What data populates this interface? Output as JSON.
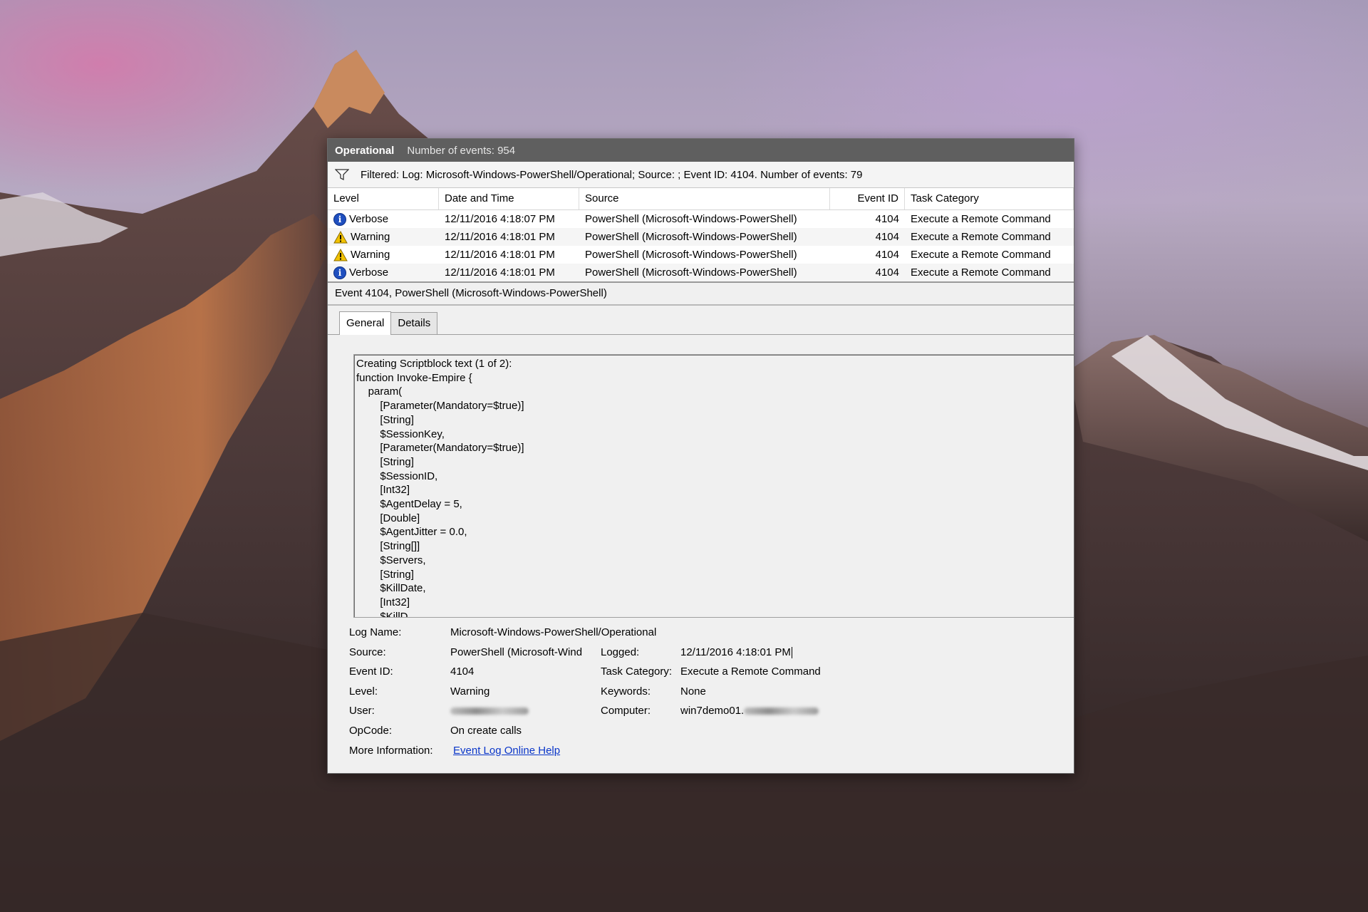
{
  "window": {
    "title": "Operational",
    "event_count": "Number of events: 954",
    "filter_text": "Filtered: Log: Microsoft-Windows-PowerShell/Operational; Source: ; Event ID: 4104. Number of events: 79"
  },
  "grid": {
    "headers": [
      "Level",
      "Date and Time",
      "Source",
      "Event ID",
      "Task Category"
    ],
    "rows": [
      {
        "level": "Verbose",
        "icon": "info-icon",
        "date": "12/11/2016 4:18:07 PM",
        "source": "PowerShell (Microsoft-Windows-PowerShell)",
        "event_id": "4104",
        "category": "Execute a Remote Command"
      },
      {
        "level": "Warning",
        "icon": "warning-icon",
        "date": "12/11/2016 4:18:01 PM",
        "source": "PowerShell (Microsoft-Windows-PowerShell)",
        "event_id": "4104",
        "category": "Execute a Remote Command"
      },
      {
        "level": "Warning",
        "icon": "warning-icon",
        "date": "12/11/2016 4:18:01 PM",
        "source": "PowerShell (Microsoft-Windows-PowerShell)",
        "event_id": "4104",
        "category": "Execute a Remote Command"
      },
      {
        "level": "Verbose",
        "icon": "info-icon",
        "date": "12/11/2016 4:18:01 PM",
        "source": "PowerShell (Microsoft-Windows-PowerShell)",
        "event_id": "4104",
        "category": "Execute a Remote Command"
      }
    ]
  },
  "detail": {
    "header": "Event 4104, PowerShell (Microsoft-Windows-PowerShell)",
    "tabs": [
      "General",
      "Details"
    ],
    "active_tab": "General",
    "script_lines": [
      "Creating Scriptblock text (1 of 2):",
      "function Invoke-Empire {",
      "    param(",
      "        [Parameter(Mandatory=$true)]",
      "        [String]",
      "        $SessionKey,",
      "        [Parameter(Mandatory=$true)]",
      "        [String]",
      "        $SessionID,",
      "        [Int32]",
      "        $AgentDelay = 5,",
      "        [Double]",
      "        $AgentJitter = 0.0,",
      "        [String[]]",
      "        $Servers,",
      "        [String]",
      "        $KillDate,",
      "        [Int32]",
      "        $KillD"
    ],
    "properties": {
      "log_name_label": "Log Name:",
      "log_name": "Microsoft-Windows-PowerShell/Operational",
      "source_label": "Source:",
      "source": "PowerShell (Microsoft-Wind",
      "logged_label": "Logged:",
      "logged": "12/11/2016 4:18:01 PM",
      "event_id_label": "Event ID:",
      "event_id": "4104",
      "task_category_label": "Task Category:",
      "task_category": "Execute a Remote Command",
      "level_label": "Level:",
      "level": "Warning",
      "keywords_label": "Keywords:",
      "keywords": "None",
      "user_label": "User:",
      "computer_label": "Computer:",
      "computer": "win7demo01.",
      "opcode_label": "OpCode:",
      "opcode": "On create calls",
      "more_info_label": "More Information:",
      "more_info_link": "Event Log Online Help"
    }
  },
  "colors": {
    "titlebar": "#5f5f5f",
    "link": "#0a36c9",
    "info_icon": "#1f4fbf",
    "warning_icon": "#f2c200"
  }
}
